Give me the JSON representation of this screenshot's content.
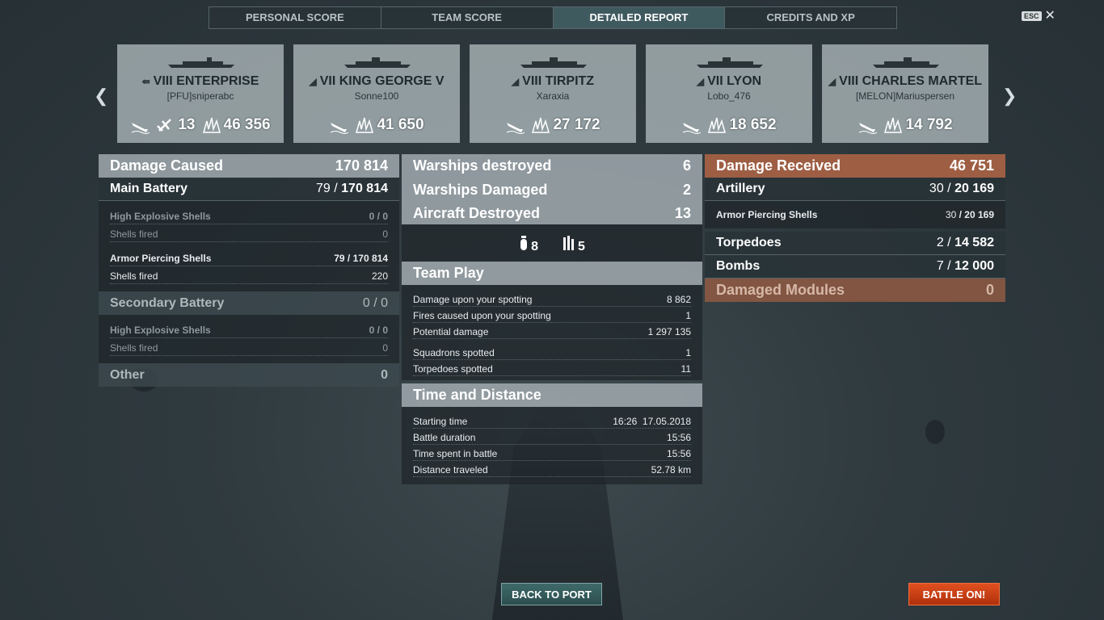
{
  "tabs": [
    "PERSONAL SCORE",
    "TEAM SCORE",
    "DETAILED REPORT",
    "CREDITS AND XP"
  ],
  "active_tab": "DETAILED REPORT",
  "esc_label": "ESC",
  "ships": [
    {
      "tier": "VIII",
      "name": "ENTERPRISE",
      "player": "[PFU]sniperabc",
      "planes": "13",
      "damage": "46 356"
    },
    {
      "tier": "VII",
      "name": "KING GEORGE V",
      "player": "Sonne100",
      "damage": "41 650"
    },
    {
      "tier": "VIII",
      "name": "TIRPITZ",
      "player": "Xaraxia",
      "damage": "27 172"
    },
    {
      "tier": "VII",
      "name": "LYON",
      "player": "Lobo_476",
      "damage": "18 652"
    },
    {
      "tier": "VIII",
      "name": "CHARLES MARTEL",
      "player": "[MELON]Mariuspersen",
      "damage": "14 792"
    }
  ],
  "damage_caused": {
    "label": "Damage Caused",
    "total": "170 814",
    "main_battery": {
      "label": "Main Battery",
      "hits": "79",
      "dmg": "170 814"
    },
    "he_shells": {
      "label": "High Explosive Shells",
      "hits": "0",
      "dmg": "0",
      "fired_label": "Shells fired",
      "fired": "0"
    },
    "ap_shells": {
      "label": "Armor Piercing Shells",
      "hits": "79",
      "dmg": "170 814",
      "fired_label": "Shells fired",
      "fired": "220"
    },
    "secondary": {
      "label": "Secondary Battery",
      "hits": "0",
      "dmg": "0"
    },
    "sec_he": {
      "label": "High Explosive Shells",
      "hits": "0",
      "dmg": "0",
      "fired_label": "Shells fired",
      "fired": "0"
    },
    "other": {
      "label": "Other",
      "value": "0"
    }
  },
  "center": {
    "warships_destroyed": {
      "label": "Warships destroyed",
      "value": "6"
    },
    "warships_damaged": {
      "label": "Warships Damaged",
      "value": "2"
    },
    "aircraft_destroyed": {
      "label": "Aircraft Destroyed",
      "value": "13"
    },
    "aircraft_icons": [
      {
        "icon": "bomb-icon",
        "count": "8"
      },
      {
        "icon": "torpedo-icon",
        "count": "5"
      }
    ],
    "team_play": {
      "title": "Team Play",
      "rows": [
        {
          "label": "Damage upon your spotting",
          "value": "8 862"
        },
        {
          "label": "Fires caused upon your spotting",
          "value": "1"
        },
        {
          "label": "Potential damage",
          "value": "1 297 135"
        },
        {
          "label": "Squadrons spotted",
          "value": "1"
        },
        {
          "label": "Torpedoes spotted",
          "value": "11"
        }
      ]
    },
    "time_distance": {
      "title": "Time and Distance",
      "rows": [
        {
          "label": "Starting time",
          "value": "16:26  17.05.2018"
        },
        {
          "label": "Battle duration",
          "value": "15:56"
        },
        {
          "label": "Time spent in battle",
          "value": "15:56"
        },
        {
          "label": "Distance traveled",
          "value": "52.78 km"
        }
      ]
    }
  },
  "damage_received": {
    "label": "Damage Received",
    "total": "46 751",
    "artillery": {
      "label": "Artillery",
      "hits": "30",
      "dmg": "20 169"
    },
    "ap_shells": {
      "label": "Armor Piercing Shells",
      "hits": "30",
      "dmg": "20 169"
    },
    "torpedoes": {
      "label": "Torpedoes",
      "hits": "2",
      "dmg": "14 582"
    },
    "bombs": {
      "label": "Bombs",
      "hits": "7",
      "dmg": "12 000"
    },
    "modules": {
      "label": "Damaged Modules",
      "value": "0"
    }
  },
  "buttons": {
    "back": "BACK TO PORT",
    "battle": "BATTLE ON!"
  },
  "colors": {
    "orange_header": "#a86244",
    "battle_button": "#d0441a",
    "active_tab": "#3f5a5f"
  }
}
